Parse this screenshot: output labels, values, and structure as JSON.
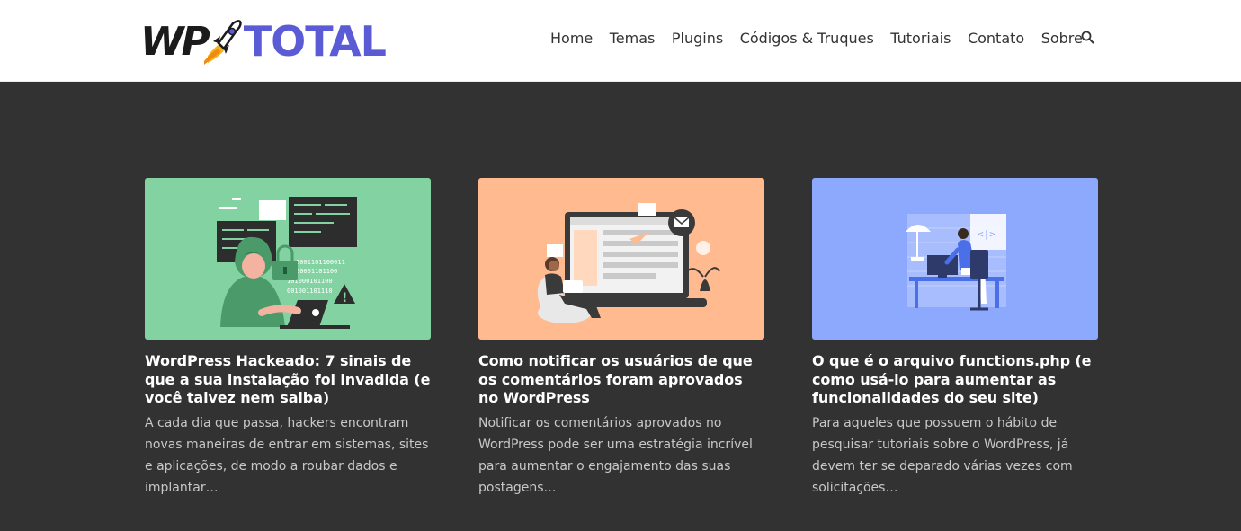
{
  "brand": {
    "logo_left": "WP",
    "logo_right": "TOTAL",
    "accent_color": "#5b5bd6"
  },
  "nav": {
    "items": [
      "Home",
      "Temas",
      "Plugins",
      "Códigos & Truques",
      "Tutoriais",
      "Contato",
      "Sobre"
    ],
    "search_icon": "search-icon"
  },
  "posts": [
    {
      "title": "WordPress Hackeado: 7 sinais de que a sua instalação foi invadida (e você talvez nem saiba)",
      "excerpt": "A cada dia que passa, hackers encontram novas maneiras de entrar em sistemas, sites e aplicações, de modo a roubar dados e implantar…",
      "image_color": "#83d3a2"
    },
    {
      "title": "Como notificar os usuários de que os comentários foram aprovados no WordPress",
      "excerpt": "Notificar os comentários aprovados no WordPress pode ser uma estratégia incrível para aumentar o engajamento das suas postagens…",
      "image_color": "#ffba8f"
    },
    {
      "title": "O que é o arquivo functions.php (e como usá-lo para aumentar as funcionalidades do seu site)",
      "excerpt": "Para aqueles que possuem o hábito de pesquisar tutoriais sobre o WordPress, já devem ter se deparado várias vezes com solicitações…",
      "image_color": "#8da9fd"
    }
  ]
}
